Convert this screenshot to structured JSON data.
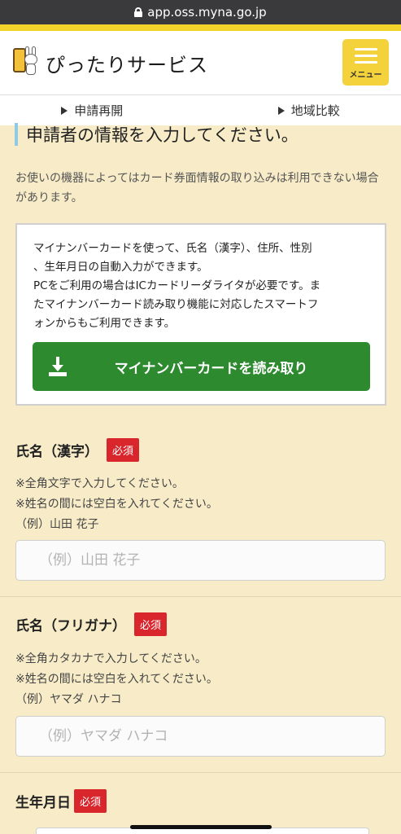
{
  "browser": {
    "url": "app.oss.myna.go.jp",
    "lock_icon": "lock-icon"
  },
  "header": {
    "site_title": "ぴったりサービス",
    "menu_label": "メニュー",
    "accent_color": "#f2d42a"
  },
  "subnav": {
    "items": [
      {
        "label": "申請再開"
      },
      {
        "label": "地域比較"
      }
    ]
  },
  "section": {
    "title": "申請者の情報を入力してください。"
  },
  "note": "お使いの機器によってはカード券面情報の取り込みは利用できない場合があります。",
  "mynumber_card": {
    "description_lines": [
      "マイナンバーカードを使って、氏名（漢字）、住所、性別",
      "、生年月日の自動入力ができます。",
      "PCをご利用の場合はICカードリーダライタが必要です。ま",
      "たマイナンバーカード読み取り機能に対応したスマートフ",
      "ォンからもご利用できます。"
    ],
    "button_label": "マイナンバーカードを読み取り",
    "button_color": "#2e8a2f"
  },
  "fields": {
    "name_kanji": {
      "title": "氏名（漢字）",
      "required": "必須",
      "hints": [
        "※全角文字で入力してください。",
        "※姓名の間には空白を入れてください。",
        "（例）山田 花子"
      ],
      "placeholder": "（例）山田 花子"
    },
    "name_kana": {
      "title": "氏名（フリガナ）",
      "required": "必須",
      "hints": [
        "※全角カタカナで入力してください。",
        "※姓名の間には空白を入れてください。",
        "（例）ヤマダ ハナコ"
      ],
      "placeholder": "（例）ヤマダ ハナコ"
    },
    "birthdate": {
      "title": "生年月日",
      "required": "必須"
    }
  },
  "colors": {
    "background": "#f8ecc8",
    "required_badge": "#d9262c",
    "heading_bar": "#8ec9e6"
  }
}
